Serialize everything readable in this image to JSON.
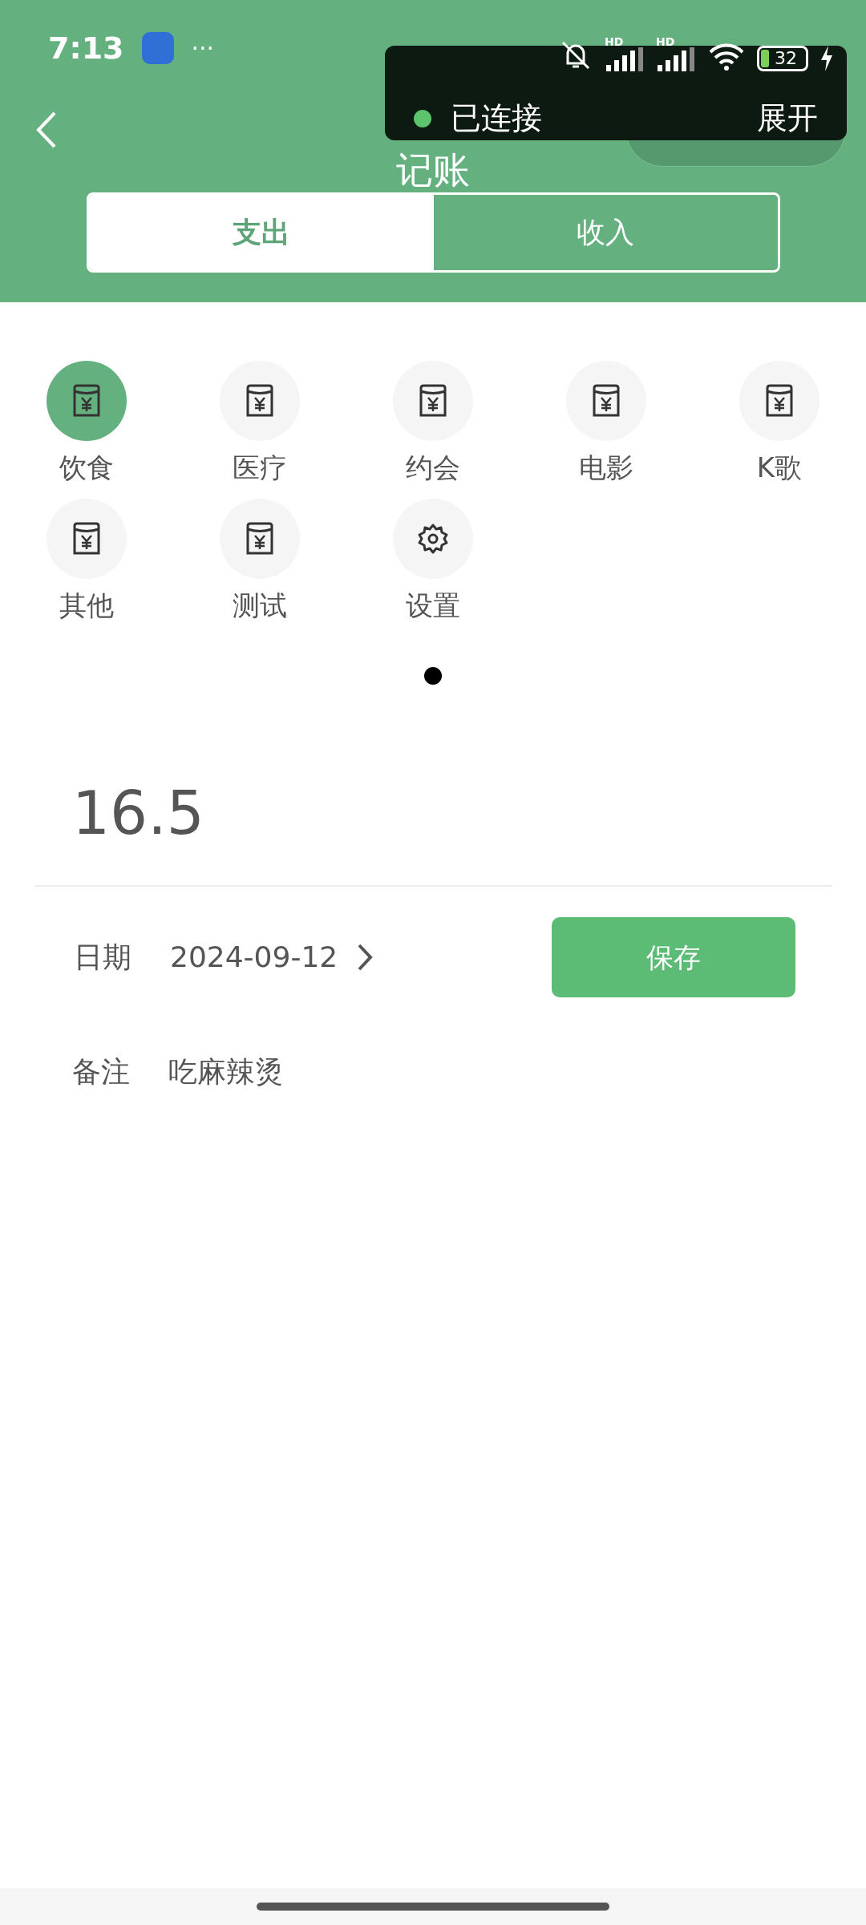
{
  "status_bar": {
    "time": "7:13",
    "more": "···",
    "signal_labels": [
      "HD",
      "HD"
    ],
    "battery": "32"
  },
  "overlay": {
    "status": "已连接",
    "action": "展开"
  },
  "header": {
    "title": "记账"
  },
  "tabs": [
    {
      "label": "支出",
      "selected": true
    },
    {
      "label": "收入",
      "selected": false
    }
  ],
  "categories": [
    {
      "label": "饮食",
      "kind": "envelope",
      "selected": true
    },
    {
      "label": "医疗",
      "kind": "envelope",
      "selected": false
    },
    {
      "label": "约会",
      "kind": "envelope",
      "selected": false
    },
    {
      "label": "电影",
      "kind": "envelope",
      "selected": false
    },
    {
      "label": "K歌",
      "kind": "envelope",
      "selected": false
    },
    {
      "label": "其他",
      "kind": "envelope",
      "selected": false
    },
    {
      "label": "测试",
      "kind": "envelope",
      "selected": false
    },
    {
      "label": "设置",
      "kind": "gear",
      "selected": false
    }
  ],
  "page_dots": [
    {
      "selected": true
    }
  ],
  "amount": "16.5",
  "date": {
    "label": "日期",
    "value": "2024-09-12"
  },
  "save_button": "保存",
  "note": {
    "label": "备注",
    "value": "吃麻辣烫"
  }
}
